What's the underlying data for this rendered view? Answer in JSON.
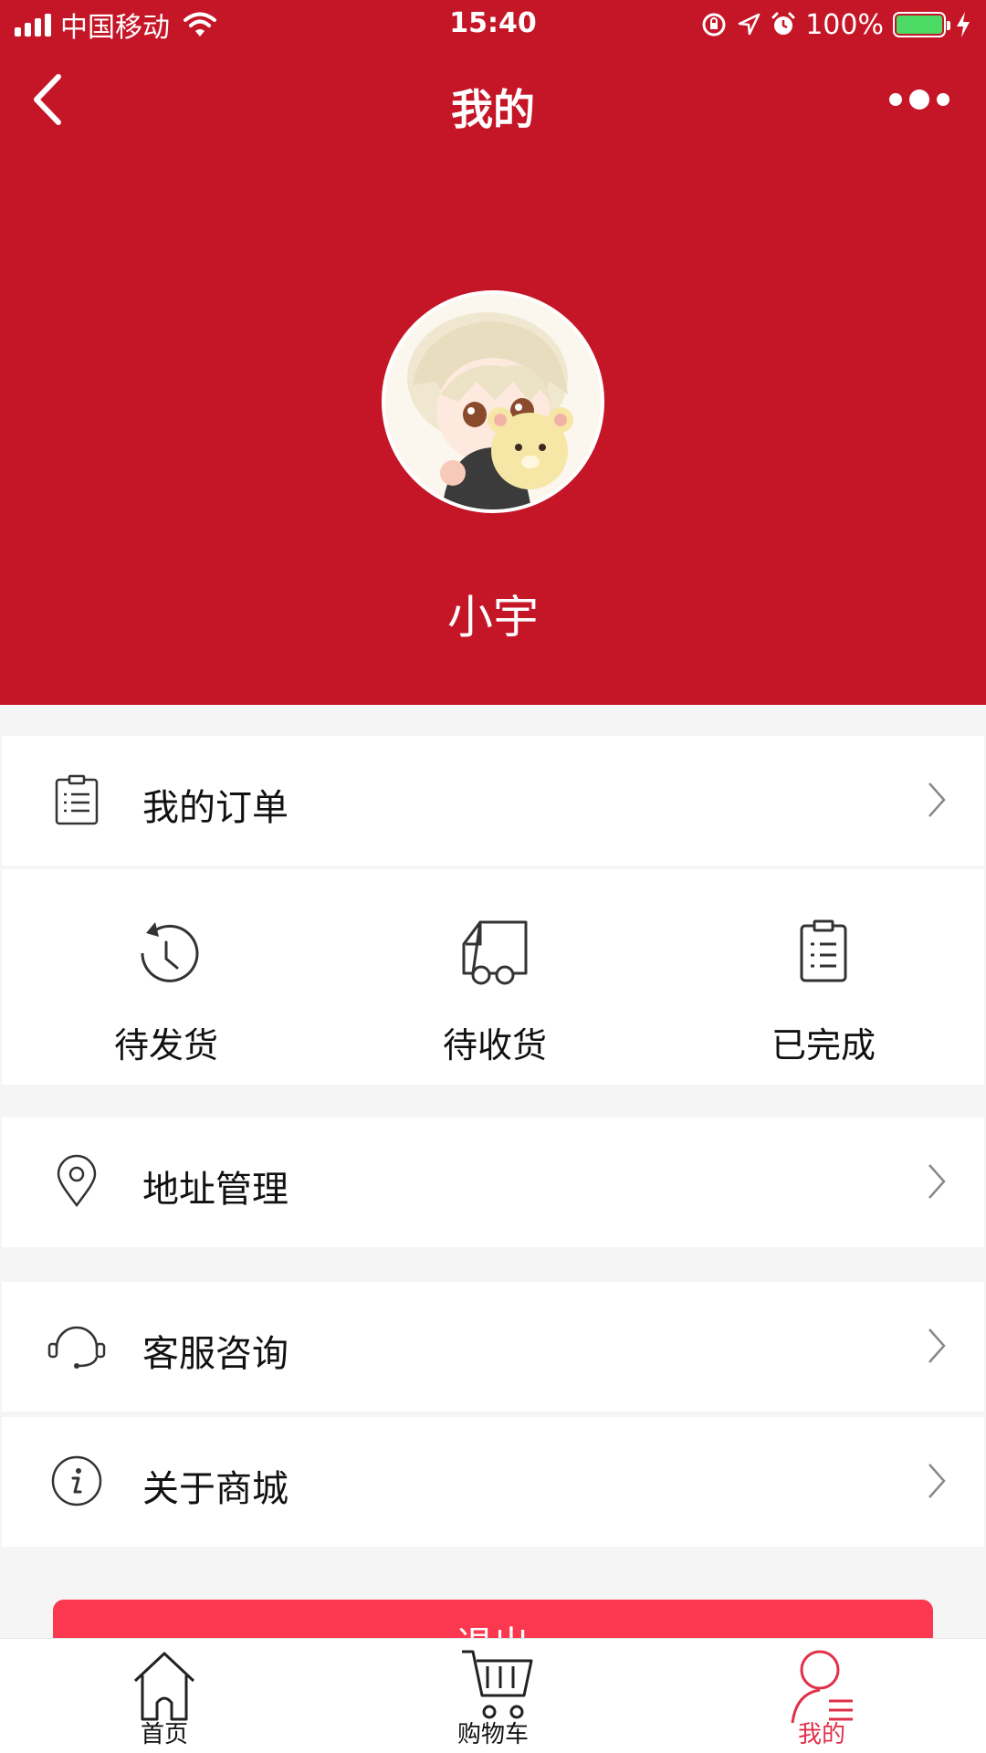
{
  "status_bar": {
    "carrier": "中国移动",
    "time": "15:40",
    "battery": "100%"
  },
  "nav": {
    "title": "我的"
  },
  "profile": {
    "username": "小宇"
  },
  "menu": {
    "orders_label": "我的订单",
    "order_status": [
      {
        "label": "待发货",
        "icon": "clock-rewind-icon"
      },
      {
        "label": "待收货",
        "icon": "delivery-truck-icon"
      },
      {
        "label": "已完成",
        "icon": "clipboard-icon"
      }
    ],
    "address_label": "地址管理",
    "support_label": "客服咨询",
    "about_label": "关于商城"
  },
  "logout_label": "退出",
  "tabs": [
    {
      "label": "首页",
      "icon": "home-icon"
    },
    {
      "label": "购物车",
      "icon": "cart-icon"
    },
    {
      "label": "我的",
      "icon": "user-icon",
      "active": true
    }
  ],
  "colors": {
    "header_red": "#c51627",
    "logout_red": "#fc3750",
    "active_tab": "#e0304a",
    "battery_green": "#4cd964"
  }
}
